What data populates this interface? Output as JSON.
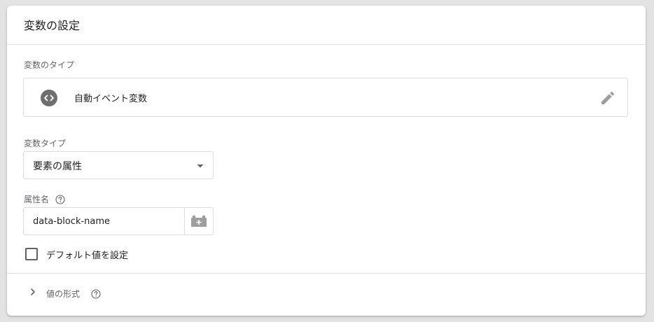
{
  "panel": {
    "title": "変数の設定"
  },
  "variable_type_section": {
    "label": "変数のタイプ",
    "type_name": "自動イベント変数",
    "icon": "code-brackets-icon",
    "edit_icon": "pencil-icon"
  },
  "variable_subtype": {
    "label": "変数タイプ",
    "selected": "要素の属性",
    "dropdown_icon": "caret-down-icon"
  },
  "attribute_name": {
    "label": "属性名",
    "help_icon": "question-circle-icon",
    "value": "data-block-name",
    "variable_picker_icon": "variable-block-icon"
  },
  "default_value": {
    "label": "デフォルト値を設定",
    "checked": false
  },
  "value_format": {
    "label": "値の形式",
    "expanded": false,
    "help_icon": "question-circle-icon"
  },
  "colors": {
    "card_bg": "#ffffff",
    "page_bg": "#e3e3e3",
    "border": "#dadce0",
    "secondary_text": "#5f6368",
    "icon_gray": "#6e6e6e"
  }
}
